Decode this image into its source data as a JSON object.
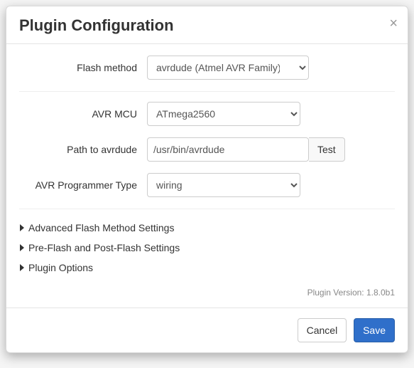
{
  "modal": {
    "title": "Plugin Configuration",
    "close_glyph": "×"
  },
  "form": {
    "flash_method": {
      "label": "Flash method",
      "value": "avrdude (Atmel AVR Family)"
    },
    "avr_mcu": {
      "label": "AVR MCU",
      "value": "ATmega2560"
    },
    "avrdude_path": {
      "label": "Path to avrdude",
      "value": "/usr/bin/avrdude",
      "test_label": "Test"
    },
    "programmer": {
      "label": "AVR Programmer Type",
      "value": "wiring"
    }
  },
  "accordion": {
    "advanced": "Advanced Flash Method Settings",
    "prepost": "Pre-Flash and Post-Flash Settings",
    "options": "Plugin Options"
  },
  "version_text": "Plugin Version: 1.8.0b1",
  "footer": {
    "cancel": "Cancel",
    "save": "Save"
  }
}
